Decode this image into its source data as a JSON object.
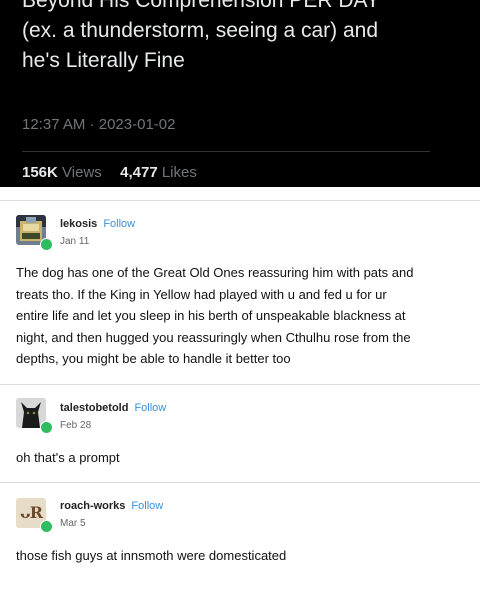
{
  "tweet": {
    "lines": [
      "Beyond His Comprehension PER DAY",
      "(ex. a thunderstorm, seeing a car) and",
      "he's Literally Fine"
    ],
    "time": "12:37 AM",
    "separator": "·",
    "date": "2023-01-02",
    "views_count": "156K",
    "views_label": "Views",
    "likes_count": "4,477",
    "likes_label": "Likes"
  },
  "replies": [
    {
      "username": "lekosis",
      "follow_label": "Follow",
      "date": "Jan 11",
      "lines": [
        "The dog has one of the Great Old Ones reassuring him with pats and",
        "treats tho. If the King in Yellow had played with u and fed u for ur",
        "entire life and let you sleep in his berth of unspeakable blackness at",
        "night, and then hugged you reassuringly when Cthulhu rose from the",
        "depths, you might be able to handle it better too"
      ]
    },
    {
      "username": "talestobetold",
      "follow_label": "Follow",
      "date": "Feb 28",
      "lines": [
        "oh that's a prompt"
      ]
    },
    {
      "username": "roach-works",
      "follow_label": "Follow",
      "date": "Mar 5",
      "avatar_text": "ᴗR",
      "lines": [
        "those fish guys at innsmoth were domesticated"
      ]
    }
  ],
  "colors": {
    "tweet_bg": "#000000",
    "link_blue": "#3a8fd9",
    "online_green": "#2fbb5f"
  }
}
